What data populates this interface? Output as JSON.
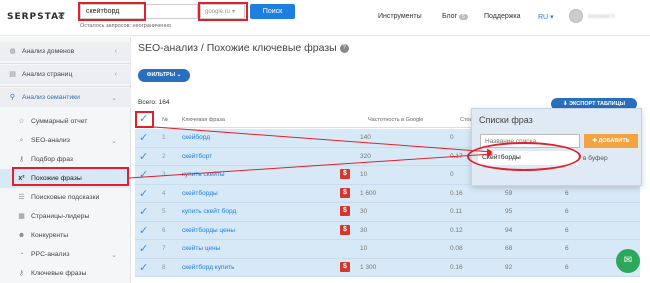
{
  "header": {
    "logo": "SERPSTAT",
    "collapse_icon": "«",
    "search_value": "скейтборд",
    "database": "google.ru",
    "search_button": "Поиск",
    "remaining": "Осталось запросов: неограниченно",
    "nav": {
      "tools": "Инструменты",
      "blog": "Блог",
      "blog_badge": "5",
      "support": "Поддержка",
      "lang": "RU"
    }
  },
  "sidebar": {
    "items": [
      {
        "label": "Анализ доменов",
        "icon": "globe-icon"
      },
      {
        "label": "Анализ страниц",
        "icon": "page-icon"
      },
      {
        "label": "Анализ семантики",
        "icon": "semantics-icon"
      },
      {
        "label": "Суммарный отчет",
        "icon": "report-icon"
      },
      {
        "label": "SEO-анализ",
        "icon": "search-icon"
      },
      {
        "label": "Подбор фраз",
        "icon": "key-icon"
      },
      {
        "label": "Похожие фразы",
        "icon": "similar-icon"
      },
      {
        "label": "Поисковые подсказки",
        "icon": "suggest-icon"
      },
      {
        "label": "Страницы-лидеры",
        "icon": "pages-icon"
      },
      {
        "label": "Конкуренты",
        "icon": "competitors-icon"
      },
      {
        "label": "PPC-анализ",
        "icon": "ppc-icon"
      },
      {
        "label": "Ключевые фразы",
        "icon": "key-icon"
      }
    ]
  },
  "main": {
    "title": "SEO-анализ / Похожие ключевые фразы",
    "filters_button": "ФИЛЬТРЫ",
    "total": "Всего: 164",
    "export_button": "ЭКСПОРТ ТАБЛИЦЫ",
    "columns": {
      "num": "№",
      "keyword": "Ключевая фраза",
      "volume": "Частотность в Google",
      "cpc": "Стоимо"
    },
    "rows": [
      {
        "num": "1",
        "kw": "скейборд",
        "vol": "140",
        "cpc": "0",
        "comp": "",
        "res": "",
        "dollar": false
      },
      {
        "num": "2",
        "kw": "скейтборт",
        "vol": "320",
        "cpc": "0.17",
        "comp": "",
        "res": "",
        "dollar": false
      },
      {
        "num": "3",
        "kw": "купить скейты",
        "vol": "10",
        "cpc": "0",
        "comp": "",
        "res": "",
        "dollar": true
      },
      {
        "num": "4",
        "kw": "скейтборды",
        "vol": "1 600",
        "cpc": "0.16",
        "comp": "59",
        "res": "6",
        "dollar": true
      },
      {
        "num": "5",
        "kw": "купить скейт борд",
        "vol": "30",
        "cpc": "0.11",
        "comp": "95",
        "res": "6",
        "dollar": true
      },
      {
        "num": "6",
        "kw": "скейтборды цены",
        "vol": "30",
        "cpc": "0.12",
        "comp": "94",
        "res": "6",
        "dollar": true
      },
      {
        "num": "7",
        "kw": "скейты цены",
        "vol": "10",
        "cpc": "0.08",
        "comp": "68",
        "res": "6",
        "dollar": false
      },
      {
        "num": "8",
        "kw": "скейтборд купить",
        "vol": "1 300",
        "cpc": "0.16",
        "comp": "92",
        "res": "6",
        "dollar": true
      }
    ]
  },
  "popup": {
    "title": "Списки фраз",
    "placeholder": "Название списка",
    "add_button": "ДОБАВИТЬ",
    "list_item": "Скейтборды",
    "extra": "в буфер"
  },
  "colors": {
    "accent": "#1e7fe0",
    "highlight": "#e0202a",
    "row_selected": "#d7e9f7",
    "add_button": "#f3a33f"
  }
}
